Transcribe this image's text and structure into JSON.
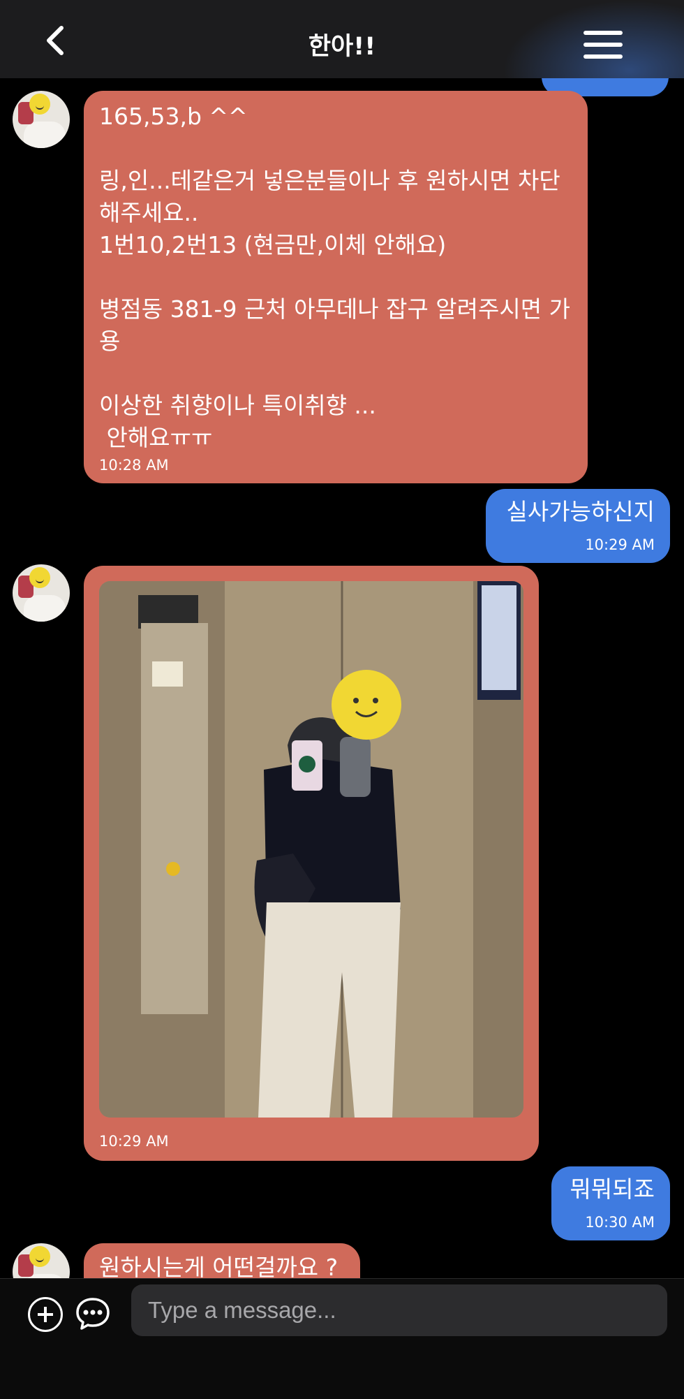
{
  "header": {
    "title": "한아!!"
  },
  "messages": [
    {
      "direction": "in",
      "text": "165,53,b ^^\n\n링,인...테같은거 넣은분들이나 후 원하시면 차단해주세요..\n1번10,2번13 (현금만,이체 안해요)\n\n병점동 381-9 근처 아무데나 잡구 알려주시면 가용\n\n이상한 취향이나 특이취향 ...\n 안해요ㅠㅠ",
      "time": "10:28 AM"
    },
    {
      "direction": "out",
      "text": "실사가능하신지",
      "time": "10:29 AM"
    },
    {
      "direction": "in",
      "type": "photo",
      "time": "10:29 AM"
    },
    {
      "direction": "out",
      "text": "뭐뭐되죠",
      "time": "10:30 AM"
    },
    {
      "direction": "in",
      "text": "원하시는게 어떤걸까요 ?"
    }
  ],
  "composer": {
    "placeholder": "Type a message..."
  },
  "colors": {
    "incoming": "#d06a5a",
    "outgoing": "#3f7be0",
    "header": "#1c1c1e"
  },
  "icons": [
    "back-icon",
    "menu-icon",
    "add-icon",
    "chat-bubble-icon",
    "avatar-icon"
  ]
}
